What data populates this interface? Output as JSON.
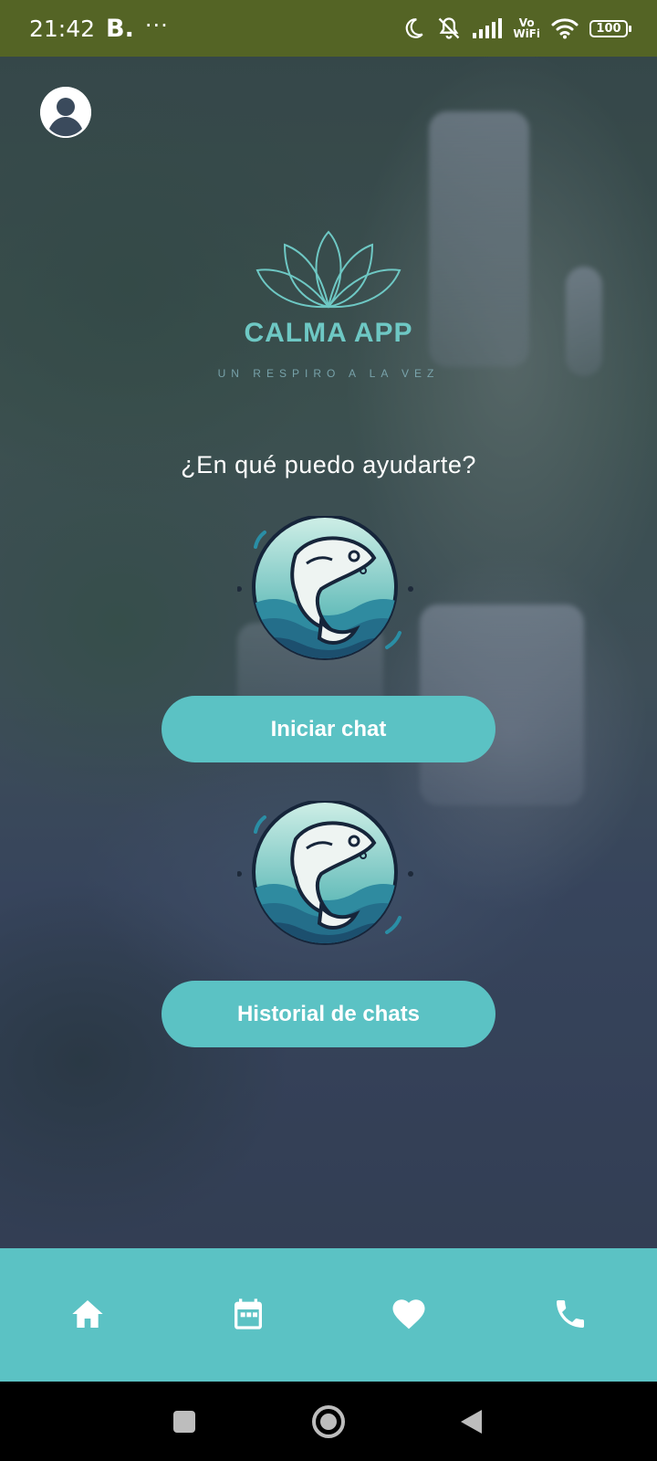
{
  "status_bar": {
    "time": "21:42",
    "app_indicator": "B.",
    "more": "···",
    "vowifi_top": "Vo",
    "vowifi_bottom": "WiFi",
    "battery": "100",
    "icons": [
      "moon-icon",
      "mute-icon",
      "signal-icon",
      "wifi-icon",
      "battery-icon"
    ]
  },
  "header": {
    "profile_icon": "account-circle-icon"
  },
  "logo": {
    "title": "CALMA APP",
    "tagline": "UN RESPIRO A LA VEZ"
  },
  "main": {
    "question": "¿En qué puedo ayudarte?",
    "start_chat_label": "Iniciar chat",
    "history_label": "Historial de chats"
  },
  "bottom_nav": {
    "items": [
      {
        "icon": "home-icon"
      },
      {
        "icon": "calendar-icon"
      },
      {
        "icon": "heart-icon"
      },
      {
        "icon": "phone-icon"
      }
    ]
  },
  "system_nav": {
    "items": [
      "recents-icon",
      "home-circle-icon",
      "back-icon"
    ]
  },
  "colors": {
    "status_bar": "#546425",
    "accent": "#5bc2c4",
    "logo_text": "#6ec8c4"
  }
}
